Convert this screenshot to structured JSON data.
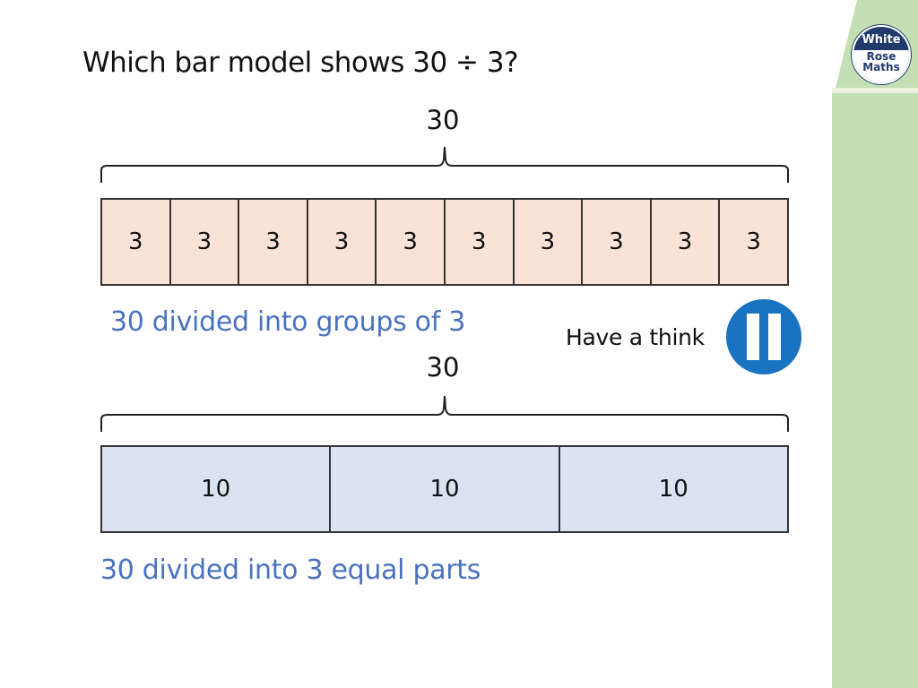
{
  "slide": {
    "question": "Which bar model shows 30 ÷ 3?",
    "brand": {
      "line1": "White",
      "line2": "Rose",
      "line3": "Maths"
    },
    "colors": {
      "accent_blue": "#4a72c0",
      "pause_blue": "#1a73c2",
      "side_green": "#c4dfb4",
      "bar_orange": "#fae3d6",
      "bar_blue": "#dae3f1",
      "logo_navy": "#1f3a6b"
    },
    "model1": {
      "total": "30",
      "cells": [
        "3",
        "3",
        "3",
        "3",
        "3",
        "3",
        "3",
        "3",
        "3",
        "3"
      ],
      "caption": "30 divided into groups of 3"
    },
    "model2": {
      "total": "30",
      "cells": [
        "10",
        "10",
        "10"
      ],
      "caption": "30 divided into 3 equal parts"
    },
    "think": {
      "label": "Have a think",
      "icon": "pause-icon"
    }
  }
}
